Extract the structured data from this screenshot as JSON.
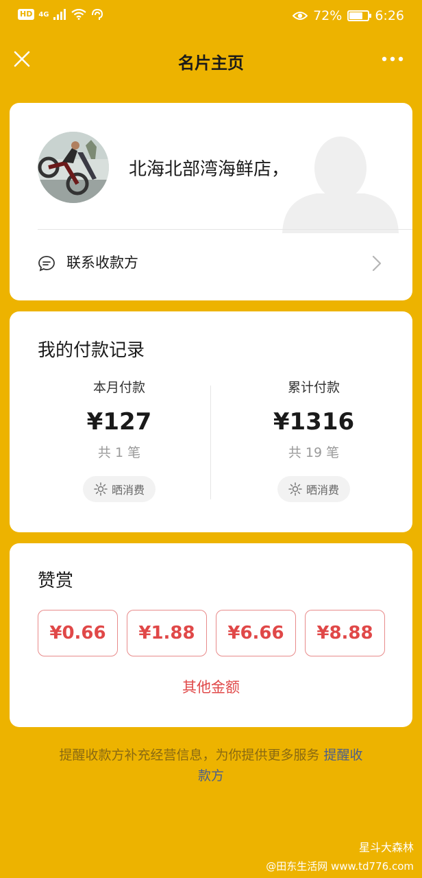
{
  "status_bar": {
    "hd": "HD",
    "network": "4G",
    "battery": "72%",
    "battery_level": 0.72,
    "time": "6:26"
  },
  "header": {
    "title": "名片主页"
  },
  "profile": {
    "shop_name": "北海北部湾海鲜店，",
    "contact_label": "联系收款方"
  },
  "records": {
    "title": "我的付款记录",
    "month": {
      "label": "本月付款",
      "amount": "¥127",
      "count": "共 1 笔",
      "share_label": "晒消费"
    },
    "total": {
      "label": "累计付款",
      "amount": "¥1316",
      "count": "共 19 笔",
      "share_label": "晒消费"
    }
  },
  "reward": {
    "title": "赞赏",
    "amounts": [
      "¥0.66",
      "¥1.88",
      "¥6.66",
      "¥8.88"
    ],
    "other_label": "其他金额"
  },
  "notice": {
    "text": "提醒收款方补充经营信息，为你提供更多服务 ",
    "link": "提醒收款方"
  },
  "watermark": {
    "line1": "星斗大森林",
    "line2": "@田东生活网 www.td776.com"
  },
  "colors": {
    "background": "#EDB300",
    "accent_red": "#E04848",
    "link_blue": "#4A5E8C"
  }
}
